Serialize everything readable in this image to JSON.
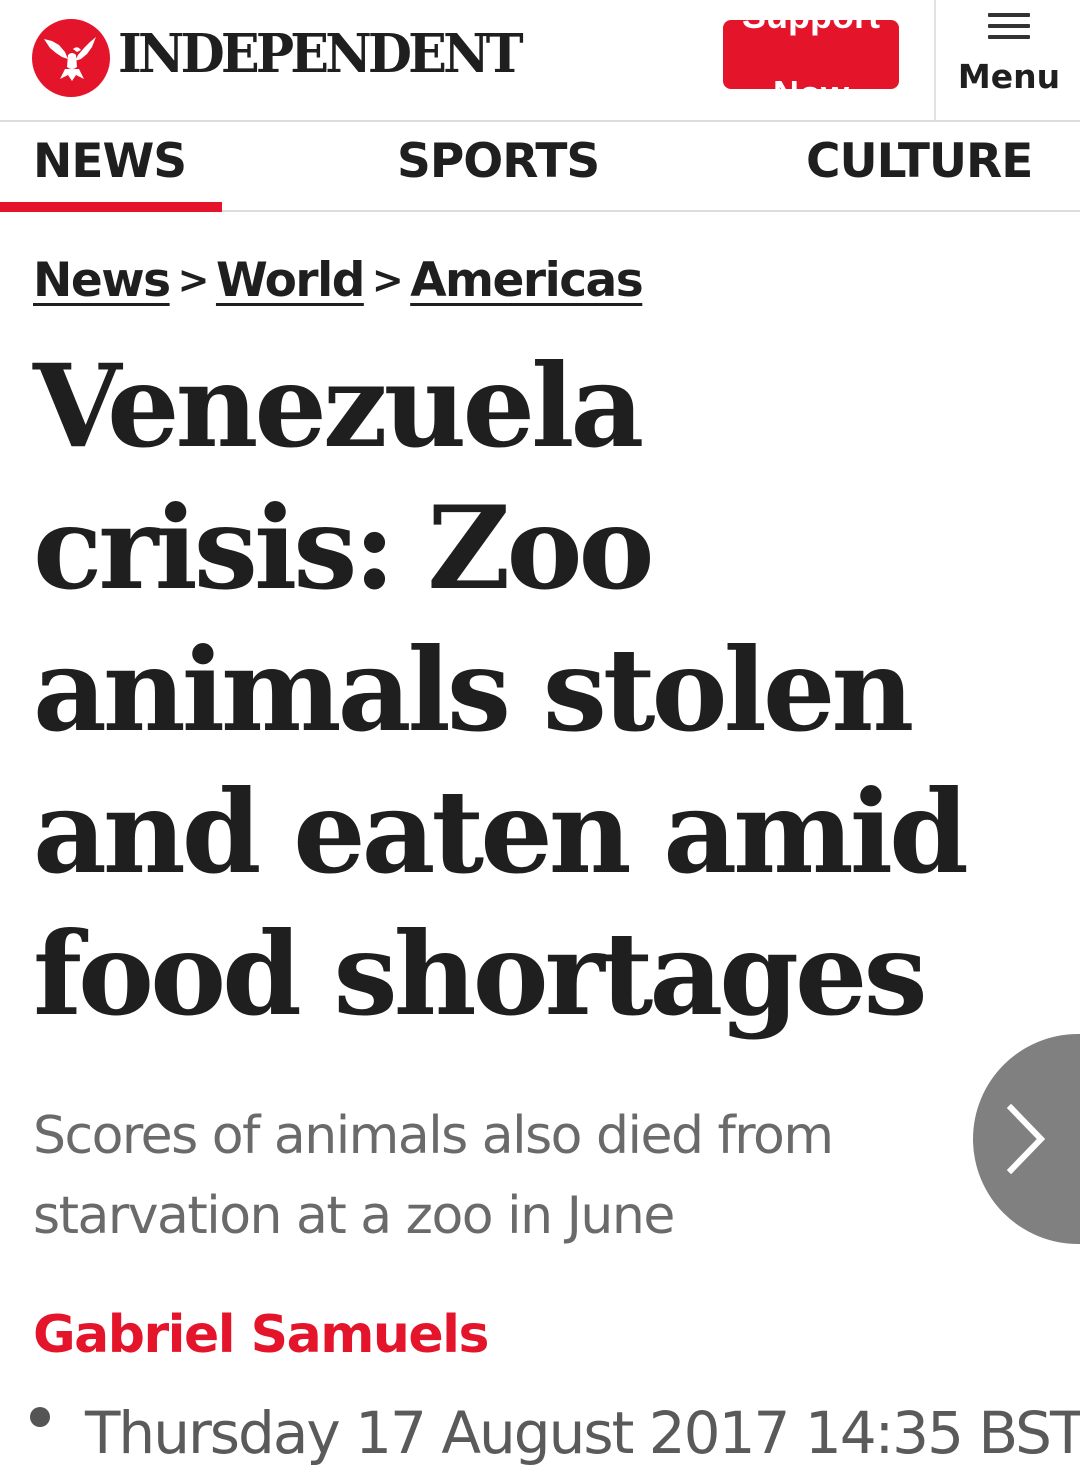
{
  "header": {
    "logo_icon": "eagle-logo-icon",
    "brand_name": "INDEPENDENT",
    "support_button": {
      "line1": "Support",
      "line2": "Now"
    },
    "menu": {
      "icon": "hamburger-icon",
      "label": "Menu"
    }
  },
  "section_nav": {
    "items": [
      {
        "label": "NEWS",
        "active": true
      },
      {
        "label": "SPORTS",
        "active": false
      },
      {
        "label": "CULTURE",
        "active": false
      }
    ]
  },
  "breadcrumb": {
    "items": [
      "News",
      "World",
      "Americas"
    ],
    "separator": ">"
  },
  "article": {
    "headline": "Venezuela crisis: Zoo animals stolen and eaten amid food shortages",
    "standfirst": "Scores of animals also died from starvation at a zoo in June",
    "author": "Gabriel Samuels",
    "date": "Thursday 17 August 2017 14:35 BST"
  },
  "next_button": {
    "icon": "chevron-right-icon"
  },
  "colors": {
    "brand_red": "#e4152b",
    "text": "#1f1f1f",
    "muted_text": "#6a6a6a",
    "next_button_bg": "#808080"
  }
}
